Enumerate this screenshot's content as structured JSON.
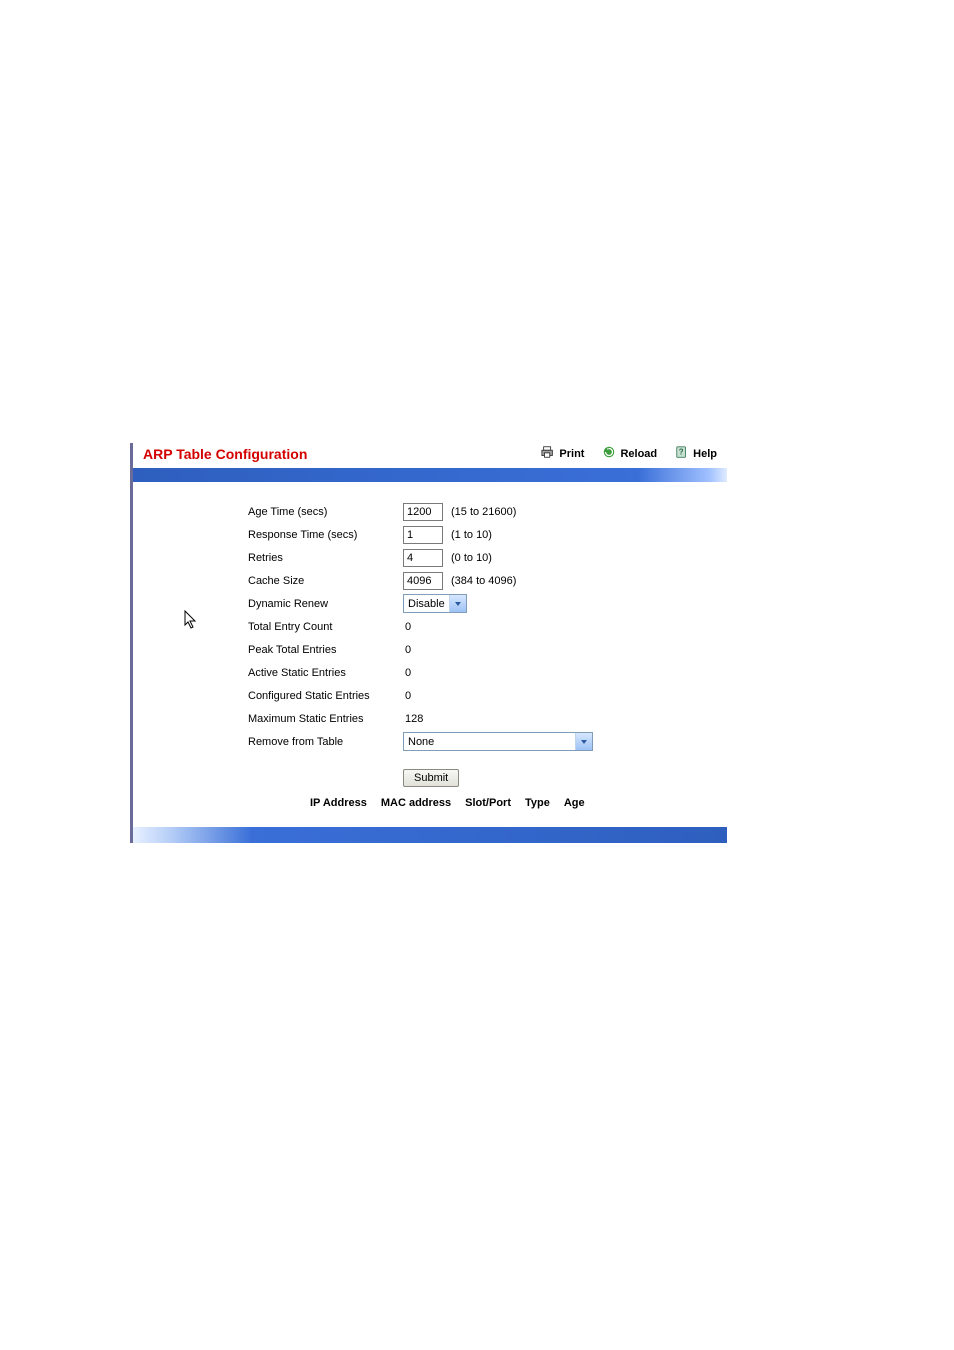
{
  "header": {
    "title": "ARP Table Configuration",
    "print_label": "Print",
    "reload_label": "Reload",
    "help_label": "Help"
  },
  "form": {
    "age_time": {
      "label": "Age Time (secs)",
      "value": "1200",
      "hint": "(15 to 21600)"
    },
    "response_time": {
      "label": "Response Time (secs)",
      "value": "1",
      "hint": "(1 to 10)"
    },
    "retries": {
      "label": "Retries",
      "value": "4",
      "hint": "(0 to 10)"
    },
    "cache_size": {
      "label": "Cache Size",
      "value": "4096",
      "hint": "(384 to 4096)"
    },
    "dynamic_renew": {
      "label": "Dynamic Renew",
      "value": "Disable"
    },
    "total_entry_count": {
      "label": "Total Entry Count",
      "value": "0"
    },
    "peak_total_entries": {
      "label": "Peak Total Entries",
      "value": "0"
    },
    "active_static_entries": {
      "label": "Active Static Entries",
      "value": "0"
    },
    "configured_static_entries": {
      "label": "Configured Static Entries",
      "value": "0"
    },
    "maximum_static_entries": {
      "label": "Maximum Static Entries",
      "value": "128"
    },
    "remove_from_table": {
      "label": "Remove from Table",
      "value": "None"
    }
  },
  "buttons": {
    "submit": "Submit"
  },
  "table_headers": {
    "ip_address": "IP Address",
    "mac_address": "MAC address",
    "slot_port": "Slot/Port",
    "type": "Type",
    "age": "Age"
  }
}
